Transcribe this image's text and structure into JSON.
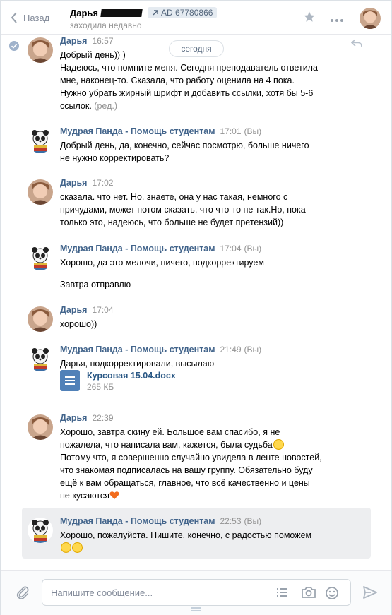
{
  "header": {
    "back_label": "Назад",
    "contact_name": "Дарья",
    "ad_label": "AD 67780866",
    "status": "заходила недавно"
  },
  "date_divider": "сегодня",
  "colors": {
    "accent": "#5181b8",
    "author": "#42648b",
    "muted": "#939393"
  },
  "messages": [
    {
      "author": "Дарья",
      "time": "16:57",
      "lines": [
        "Добрый день)) )",
        "Надеюсь, что помните меня. Сегодня преподаватель ответила",
        "мне, наконец-то. Сказала, что работу оценила на 4 пока.",
        "Нужно убрать жирный шрифт и добавить ссылки, хотя бы 5-6",
        "ссылок."
      ],
      "edited_label": "(ред.)"
    },
    {
      "author": "Мудрая Панда - Помощь студентам",
      "time": "17:01",
      "you_label": "(Вы)",
      "lines": [
        "Добрый день, да, конечно, сейчас посмотрю, больше ничего",
        "не нужно корректировать?"
      ]
    },
    {
      "author": "Дарья",
      "time": "17:02",
      "lines": [
        "сказала. что нет. Но. знаете, она у нас такая, немного с",
        "причудами, может потом сказать, что что-то не так.Но, пока",
        "только это, надеюсь, что больше не будет претензий))"
      ]
    },
    {
      "author": "Мудрая Панда - Помощь студентам",
      "time": "17:04",
      "you_label": "(Вы)",
      "lines": [
        "Хорошо, да это мелочи, ничего, подкорректируем",
        "",
        "Завтра отправлю"
      ]
    },
    {
      "author": "Дарья",
      "time": "17:04",
      "lines": [
        "хорошо))"
      ]
    },
    {
      "author": "Мудрая Панда - Помощь студентам",
      "time": "21:49",
      "you_label": "(Вы)",
      "lines": [
        "Дарья, подкорректировали, высылаю"
      ],
      "file": {
        "name": "Курсовая 15.04.docx",
        "size": "265 КБ"
      }
    },
    {
      "author": "Дарья",
      "time": "22:39",
      "lines": [
        "Хорошо, завтра скину ей. Большое вам спасибо, я не",
        "пожалела, что написала вам, кажется, была судьба",
        "Потому что, я совершенно случайно увидела в ленте новостей,",
        "что знакомая подписалась на вашу группу. Обязательно буду",
        "ещё к вам обращаться, главное, что всё качественно и цены",
        "не кусаются"
      ]
    },
    {
      "author": "Мудрая Панда - Помощь студентам",
      "time": "22:53",
      "you_label": "(Вы)",
      "lines": [
        "Хорошо, пожалуйста. Пишите, конечно, с радостью поможем"
      ]
    }
  ],
  "composer": {
    "placeholder": "Напишите сообщение..."
  }
}
